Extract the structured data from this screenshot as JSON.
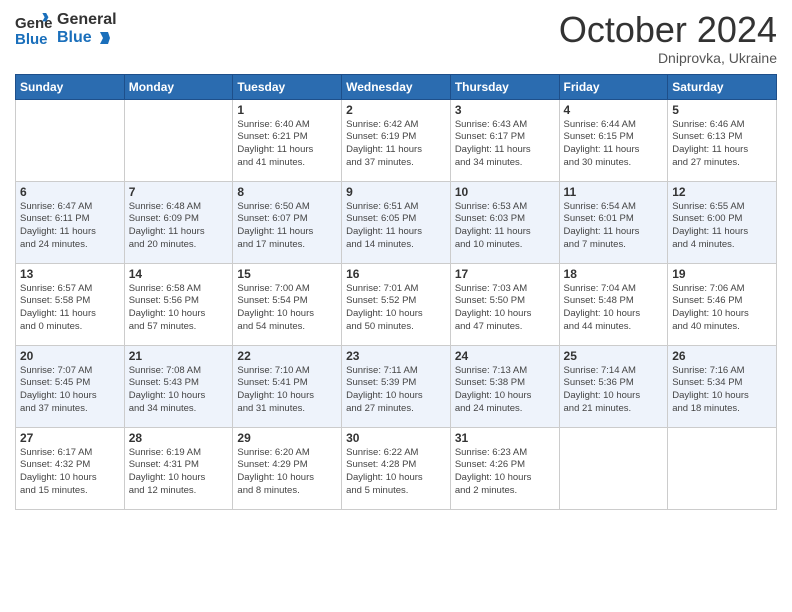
{
  "header": {
    "logo_general": "General",
    "logo_blue": "Blue",
    "month_title": "October 2024",
    "subtitle": "Dniprovka, Ukraine"
  },
  "days_of_week": [
    "Sunday",
    "Monday",
    "Tuesday",
    "Wednesday",
    "Thursday",
    "Friday",
    "Saturday"
  ],
  "weeks": [
    [
      {
        "day": "",
        "info": ""
      },
      {
        "day": "",
        "info": ""
      },
      {
        "day": "1",
        "info": "Sunrise: 6:40 AM\nSunset: 6:21 PM\nDaylight: 11 hours\nand 41 minutes."
      },
      {
        "day": "2",
        "info": "Sunrise: 6:42 AM\nSunset: 6:19 PM\nDaylight: 11 hours\nand 37 minutes."
      },
      {
        "day": "3",
        "info": "Sunrise: 6:43 AM\nSunset: 6:17 PM\nDaylight: 11 hours\nand 34 minutes."
      },
      {
        "day": "4",
        "info": "Sunrise: 6:44 AM\nSunset: 6:15 PM\nDaylight: 11 hours\nand 30 minutes."
      },
      {
        "day": "5",
        "info": "Sunrise: 6:46 AM\nSunset: 6:13 PM\nDaylight: 11 hours\nand 27 minutes."
      }
    ],
    [
      {
        "day": "6",
        "info": "Sunrise: 6:47 AM\nSunset: 6:11 PM\nDaylight: 11 hours\nand 24 minutes."
      },
      {
        "day": "7",
        "info": "Sunrise: 6:48 AM\nSunset: 6:09 PM\nDaylight: 11 hours\nand 20 minutes."
      },
      {
        "day": "8",
        "info": "Sunrise: 6:50 AM\nSunset: 6:07 PM\nDaylight: 11 hours\nand 17 minutes."
      },
      {
        "day": "9",
        "info": "Sunrise: 6:51 AM\nSunset: 6:05 PM\nDaylight: 11 hours\nand 14 minutes."
      },
      {
        "day": "10",
        "info": "Sunrise: 6:53 AM\nSunset: 6:03 PM\nDaylight: 11 hours\nand 10 minutes."
      },
      {
        "day": "11",
        "info": "Sunrise: 6:54 AM\nSunset: 6:01 PM\nDaylight: 11 hours\nand 7 minutes."
      },
      {
        "day": "12",
        "info": "Sunrise: 6:55 AM\nSunset: 6:00 PM\nDaylight: 11 hours\nand 4 minutes."
      }
    ],
    [
      {
        "day": "13",
        "info": "Sunrise: 6:57 AM\nSunset: 5:58 PM\nDaylight: 11 hours\nand 0 minutes."
      },
      {
        "day": "14",
        "info": "Sunrise: 6:58 AM\nSunset: 5:56 PM\nDaylight: 10 hours\nand 57 minutes."
      },
      {
        "day": "15",
        "info": "Sunrise: 7:00 AM\nSunset: 5:54 PM\nDaylight: 10 hours\nand 54 minutes."
      },
      {
        "day": "16",
        "info": "Sunrise: 7:01 AM\nSunset: 5:52 PM\nDaylight: 10 hours\nand 50 minutes."
      },
      {
        "day": "17",
        "info": "Sunrise: 7:03 AM\nSunset: 5:50 PM\nDaylight: 10 hours\nand 47 minutes."
      },
      {
        "day": "18",
        "info": "Sunrise: 7:04 AM\nSunset: 5:48 PM\nDaylight: 10 hours\nand 44 minutes."
      },
      {
        "day": "19",
        "info": "Sunrise: 7:06 AM\nSunset: 5:46 PM\nDaylight: 10 hours\nand 40 minutes."
      }
    ],
    [
      {
        "day": "20",
        "info": "Sunrise: 7:07 AM\nSunset: 5:45 PM\nDaylight: 10 hours\nand 37 minutes."
      },
      {
        "day": "21",
        "info": "Sunrise: 7:08 AM\nSunset: 5:43 PM\nDaylight: 10 hours\nand 34 minutes."
      },
      {
        "day": "22",
        "info": "Sunrise: 7:10 AM\nSunset: 5:41 PM\nDaylight: 10 hours\nand 31 minutes."
      },
      {
        "day": "23",
        "info": "Sunrise: 7:11 AM\nSunset: 5:39 PM\nDaylight: 10 hours\nand 27 minutes."
      },
      {
        "day": "24",
        "info": "Sunrise: 7:13 AM\nSunset: 5:38 PM\nDaylight: 10 hours\nand 24 minutes."
      },
      {
        "day": "25",
        "info": "Sunrise: 7:14 AM\nSunset: 5:36 PM\nDaylight: 10 hours\nand 21 minutes."
      },
      {
        "day": "26",
        "info": "Sunrise: 7:16 AM\nSunset: 5:34 PM\nDaylight: 10 hours\nand 18 minutes."
      }
    ],
    [
      {
        "day": "27",
        "info": "Sunrise: 6:17 AM\nSunset: 4:32 PM\nDaylight: 10 hours\nand 15 minutes."
      },
      {
        "day": "28",
        "info": "Sunrise: 6:19 AM\nSunset: 4:31 PM\nDaylight: 10 hours\nand 12 minutes."
      },
      {
        "day": "29",
        "info": "Sunrise: 6:20 AM\nSunset: 4:29 PM\nDaylight: 10 hours\nand 8 minutes."
      },
      {
        "day": "30",
        "info": "Sunrise: 6:22 AM\nSunset: 4:28 PM\nDaylight: 10 hours\nand 5 minutes."
      },
      {
        "day": "31",
        "info": "Sunrise: 6:23 AM\nSunset: 4:26 PM\nDaylight: 10 hours\nand 2 minutes."
      },
      {
        "day": "",
        "info": ""
      },
      {
        "day": "",
        "info": ""
      }
    ]
  ]
}
